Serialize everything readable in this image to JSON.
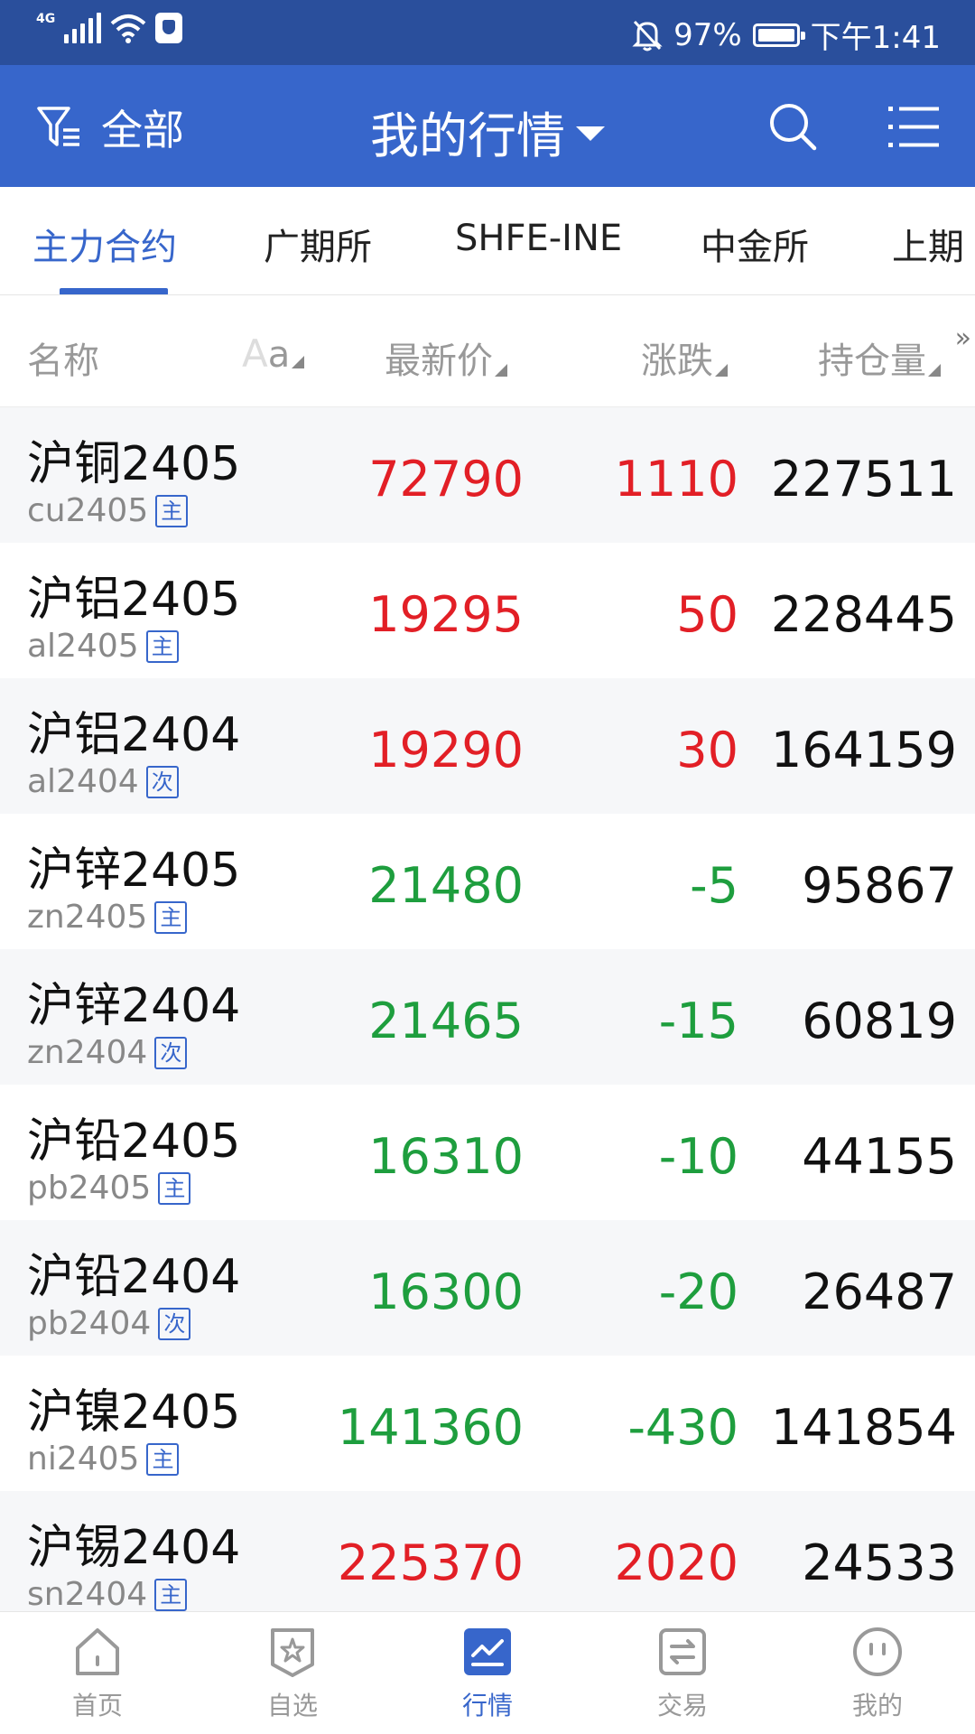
{
  "status_bar": {
    "network": "4G",
    "battery": "97%",
    "time": "下午1:41"
  },
  "header": {
    "filter_label": "全部",
    "title": "我的行情"
  },
  "tabs": [
    {
      "label": "主力合约",
      "active": true
    },
    {
      "label": "广期所",
      "active": false
    },
    {
      "label": "SHFE-INE",
      "active": false
    },
    {
      "label": "中金所",
      "active": false
    },
    {
      "label": "上期",
      "active": false
    }
  ],
  "columns": {
    "name": "名称",
    "aa_big": "A",
    "aa_small": "a",
    "price": "最新价",
    "change": "涨跌",
    "open_interest": "持仓量",
    "more": "»"
  },
  "rows": [
    {
      "name": "沪铜2405",
      "code": "cu2405",
      "tag": "主",
      "price": "72790",
      "change": "1110",
      "oi": "227511",
      "dir": "up"
    },
    {
      "name": "沪铝2405",
      "code": "al2405",
      "tag": "主",
      "price": "19295",
      "change": "50",
      "oi": "228445",
      "dir": "up"
    },
    {
      "name": "沪铝2404",
      "code": "al2404",
      "tag": "次",
      "price": "19290",
      "change": "30",
      "oi": "164159",
      "dir": "up"
    },
    {
      "name": "沪锌2405",
      "code": "zn2405",
      "tag": "主",
      "price": "21480",
      "change": "-5",
      "oi": "95867",
      "dir": "down"
    },
    {
      "name": "沪锌2404",
      "code": "zn2404",
      "tag": "次",
      "price": "21465",
      "change": "-15",
      "oi": "60819",
      "dir": "down"
    },
    {
      "name": "沪铅2405",
      "code": "pb2405",
      "tag": "主",
      "price": "16310",
      "change": "-10",
      "oi": "44155",
      "dir": "down"
    },
    {
      "name": "沪铅2404",
      "code": "pb2404",
      "tag": "次",
      "price": "16300",
      "change": "-20",
      "oi": "26487",
      "dir": "down"
    },
    {
      "name": "沪镍2405",
      "code": "ni2405",
      "tag": "主",
      "price": "141360",
      "change": "-430",
      "oi": "141854",
      "dir": "down"
    },
    {
      "name": "沪锡2404",
      "code": "sn2404",
      "tag": "主",
      "price": "225370",
      "change": "2020",
      "oi": "24533",
      "dir": "up"
    }
  ],
  "bottom_nav": [
    {
      "label": "首页",
      "icon": "home-icon",
      "active": false
    },
    {
      "label": "自选",
      "icon": "star-badge-icon",
      "active": false
    },
    {
      "label": "行情",
      "icon": "chart-icon",
      "active": true
    },
    {
      "label": "交易",
      "icon": "swap-icon",
      "active": false
    },
    {
      "label": "我的",
      "icon": "face-icon",
      "active": false
    }
  ],
  "colors": {
    "header_bg": "#3766cb",
    "statusbar_bg": "#2a4f9c",
    "up": "#e21f26",
    "down": "#1e9e3e",
    "accent": "#3766cb"
  }
}
